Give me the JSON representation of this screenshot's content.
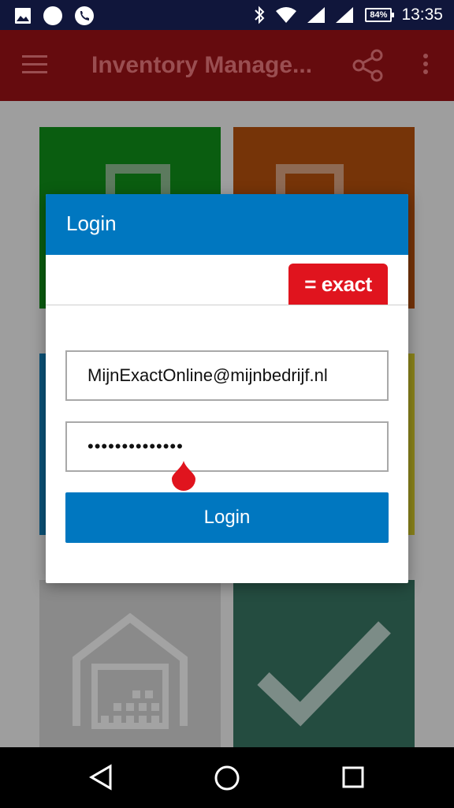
{
  "status_bar": {
    "time": "13:35",
    "battery": "84%",
    "icons_left": [
      "image-icon",
      "circle-icon",
      "phone-icon"
    ],
    "icons_right": [
      "bluetooth-icon",
      "wifi-icon",
      "signal-icon",
      "signal-2-icon",
      "battery-icon"
    ]
  },
  "app_bar": {
    "title": "Inventory Manage...",
    "color": "#650b0e",
    "icons": [
      "menu-icon",
      "share-icon",
      "more-vert-icon"
    ]
  },
  "tiles": [
    {
      "color": "#0a5d10",
      "icon": "square-icon"
    },
    {
      "color": "#763408",
      "icon": "square-icon"
    },
    {
      "color": "#0b5378",
      "icon": ""
    },
    {
      "color": "#8c841b",
      "icon": ""
    },
    {
      "color": "#8a8a8a",
      "icon": "warehouse-icon"
    },
    {
      "color": "#244c40",
      "icon": "checkmark-icon"
    }
  ],
  "dialog": {
    "title": "Login",
    "logo_text": "= exact",
    "email_value": "MijnExactOnline@mijnbedrijf.nl",
    "password_value": "••••••••••••••",
    "login_button": "Login",
    "accent": "#0077c0",
    "logo_color": "#e0141e"
  },
  "nav_bar": {
    "buttons": [
      "back-icon",
      "home-icon",
      "recents-icon"
    ]
  }
}
